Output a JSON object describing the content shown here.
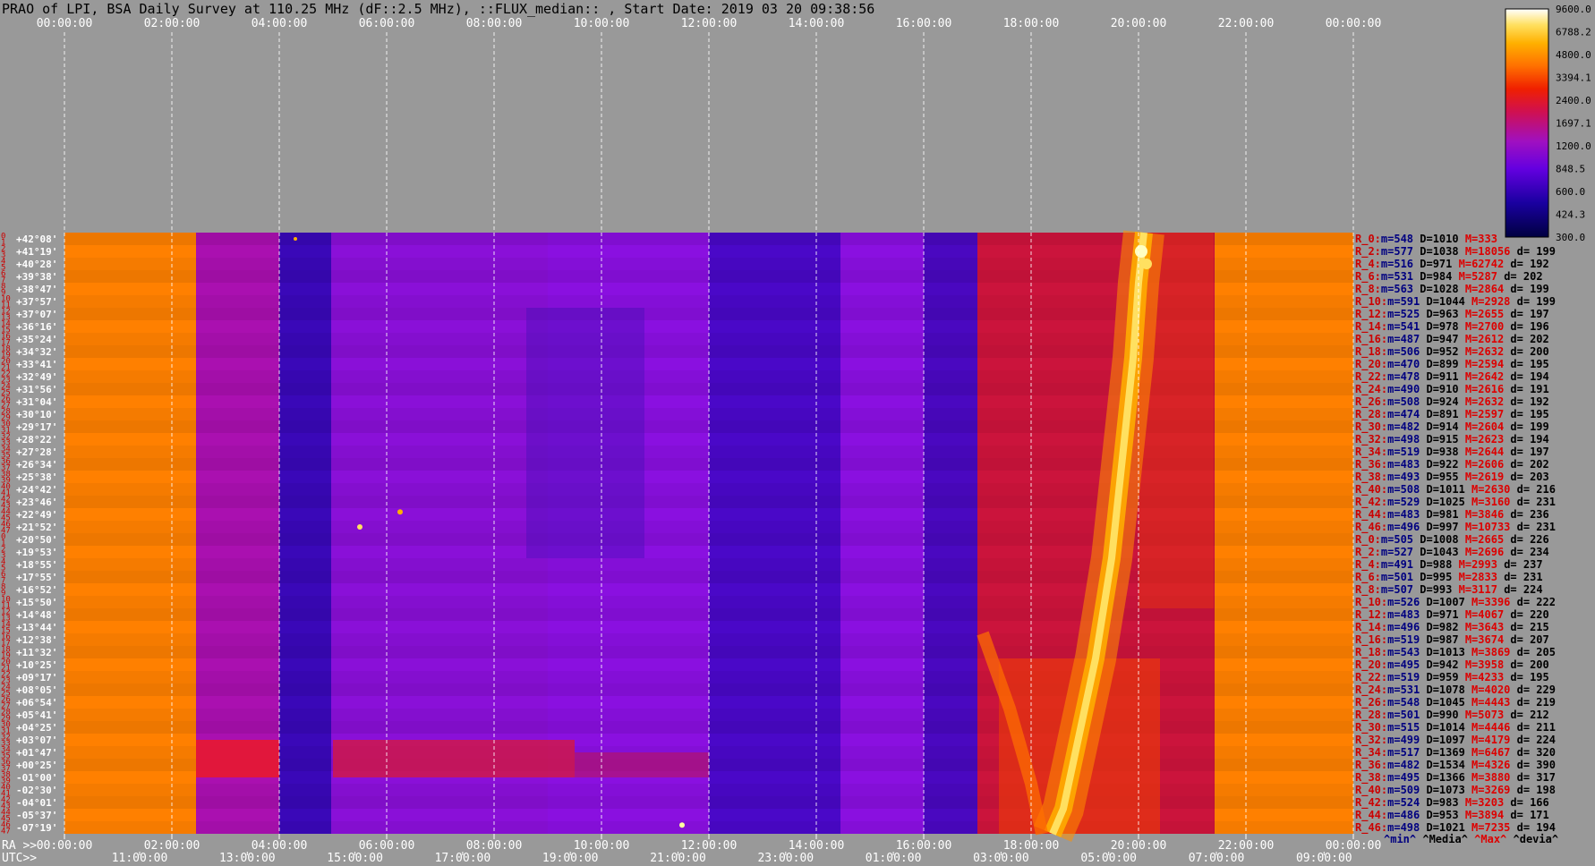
{
  "chart_data": {
    "type": "heatmap",
    "title": "PRAO of LPI, BSA Daily Survey at 110.25 MHz (dF::2.5 MHz), ::FLUX_median:: , Start Date: 2019 03 20 09:38:56",
    "x_top_ticks": [
      "00:00:00",
      "02:00:00",
      "04:00:00",
      "06:00:00",
      "08:00:00",
      "10:00:00",
      "12:00:00",
      "14:00:00",
      "16:00:00",
      "18:00:00",
      "20:00:00",
      "22:00:00",
      "00:00:00"
    ],
    "x_ra_ticks": [
      "00:00:00",
      "02:00:00",
      "04:00:00",
      "06:00:00",
      "08:00:00",
      "10:00:00",
      "12:00:00",
      "14:00:00",
      "16:00:00",
      "18:00:00",
      "20:00:00",
      "22:00:00",
      "00:00:00"
    ],
    "x_utc_ticks": [
      "11:00:00",
      "13:00:00",
      "15:00:00",
      "17:00:00",
      "19:00:00",
      "21:00:00",
      "23:00:00",
      "01:00:00",
      "03:00:00",
      "05:00:00",
      "07:00:00",
      "09:00:00"
    ],
    "ra_label": "RA >>",
    "utc_label": "UTC>>",
    "colorbar": {
      "ticks": [
        "9600.0",
        "6788.2",
        "4800.0",
        "3394.1",
        "2400.0",
        "1697.1",
        "1200.0",
        "848.5",
        "600.0",
        "424.3",
        "300.0"
      ],
      "colors": [
        "#000044",
        "#2200aa",
        "#6a00e0",
        "#a010c0",
        "#cc1040",
        "#ee2000",
        "#ff7000",
        "#ffb000",
        "#ffe060",
        "#ffffe0",
        "#ffffff"
      ]
    },
    "declinations": [
      "+42°08'",
      "+41°19'",
      "+40°28'",
      "+39°38'",
      "+38°47'",
      "+37°57'",
      "+37°07'",
      "+36°16'",
      "+35°24'",
      "+34°32'",
      "+33°41'",
      "+32°49'",
      "+31°56'",
      "+31°04'",
      "+30°10'",
      "+29°17'",
      "+28°22'",
      "+27°28'",
      "+26°34'",
      "+25°38'",
      "+24°42'",
      "+23°46'",
      "+22°49'",
      "+21°52'",
      "+20°50'",
      "+19°53'",
      "+18°55'",
      "+17°55'",
      "+16°52'",
      "+15°50'",
      "+14°48'",
      "+13°44'",
      "+12°38'",
      "+11°32'",
      "+10°25'",
      "+09°17'",
      "+08°05'",
      "+06°54'",
      "+05°41'",
      "+04°25'",
      "+03°07'",
      "+01°47'",
      "+00°25'",
      "-01°00'",
      "-02°30'",
      "-04°01'",
      "-05°37'",
      "-07°19'"
    ],
    "row_indices": [
      "0",
      "1",
      "2",
      "3",
      "4",
      "5",
      "6",
      "7",
      "8",
      "9",
      "10",
      "11",
      "12",
      "13",
      "14",
      "15",
      "16",
      "17",
      "18",
      "19",
      "20",
      "21",
      "22",
      "23",
      "24",
      "25",
      "26",
      "27",
      "28",
      "29",
      "30",
      "31",
      "32",
      "33",
      "34",
      "35",
      "36",
      "37",
      "38",
      "39",
      "40",
      "41",
      "42",
      "43",
      "44",
      "45",
      "46",
      "47",
      "0",
      "1",
      "2",
      "3",
      "4",
      "5",
      "6",
      "7",
      "8",
      "9",
      "10",
      "11",
      "12",
      "13",
      "14",
      "15",
      "16",
      "17",
      "18",
      "19",
      "20",
      "21",
      "22",
      "23",
      "24",
      "25",
      "26",
      "27",
      "28",
      "29",
      "30",
      "31",
      "32",
      "33",
      "34",
      "35",
      "36",
      "37",
      "38",
      "39",
      "40",
      "41",
      "42",
      "43",
      "44",
      "45",
      "46",
      "47"
    ],
    "row_stats": [
      {
        "label": "R_0:",
        "m": "m=548",
        "d": "D=1010",
        "M": "M=333",
        "dev": ""
      },
      {
        "label": "R_2:",
        "m": "m=577",
        "d": "D=1038",
        "M": "M=18056",
        "dev": "d= 199"
      },
      {
        "label": "R_4:",
        "m": "m=516",
        "d": "D=971",
        "M": "M=62742",
        "dev": "d= 192"
      },
      {
        "label": "R_6:",
        "m": "m=531",
        "d": "D=984",
        "M": "M=5287",
        "dev": "d= 202"
      },
      {
        "label": "R_8:",
        "m": "m=563",
        "d": "D=1028",
        "M": "M=2864",
        "dev": "d= 199"
      },
      {
        "label": "R_10:",
        "m": "m=591",
        "d": "D=1044",
        "M": "M=2928",
        "dev": "d= 199"
      },
      {
        "label": "R_12:",
        "m": "m=525",
        "d": "D=963",
        "M": "M=2655",
        "dev": "d= 197"
      },
      {
        "label": "R_14:",
        "m": "m=541",
        "d": "D=978",
        "M": "M=2700",
        "dev": "d= 196"
      },
      {
        "label": "R_16:",
        "m": "m=487",
        "d": "D=947",
        "M": "M=2612",
        "dev": "d= 202"
      },
      {
        "label": "R_18:",
        "m": "m=506",
        "d": "D=952",
        "M": "M=2632",
        "dev": "d= 200"
      },
      {
        "label": "R_20:",
        "m": "m=470",
        "d": "D=899",
        "M": "M=2594",
        "dev": "d= 195"
      },
      {
        "label": "R_22:",
        "m": "m=478",
        "d": "D=911",
        "M": "M=2642",
        "dev": "d= 194"
      },
      {
        "label": "R_24:",
        "m": "m=490",
        "d": "D=910",
        "M": "M=2616",
        "dev": "d= 191"
      },
      {
        "label": "R_26:",
        "m": "m=508",
        "d": "D=924",
        "M": "M=2632",
        "dev": "d= 192"
      },
      {
        "label": "R_28:",
        "m": "m=474",
        "d": "D=891",
        "M": "M=2597",
        "dev": "d= 195"
      },
      {
        "label": "R_30:",
        "m": "m=482",
        "d": "D=914",
        "M": "M=2604",
        "dev": "d= 199"
      },
      {
        "label": "R_32:",
        "m": "m=498",
        "d": "D=915",
        "M": "M=2623",
        "dev": "d= 194"
      },
      {
        "label": "R_34:",
        "m": "m=519",
        "d": "D=938",
        "M": "M=2644",
        "dev": "d= 197"
      },
      {
        "label": "R_36:",
        "m": "m=483",
        "d": "D=922",
        "M": "M=2606",
        "dev": "d= 202"
      },
      {
        "label": "R_38:",
        "m": "m=493",
        "d": "D=955",
        "M": "M=2619",
        "dev": "d= 203"
      },
      {
        "label": "R_40:",
        "m": "m=508",
        "d": "D=1011",
        "M": "M=2630",
        "dev": "d= 216"
      },
      {
        "label": "R_42:",
        "m": "m=529",
        "d": "D=1025",
        "M": "M=3160",
        "dev": "d= 231"
      },
      {
        "label": "R_44:",
        "m": "m=483",
        "d": "D=981",
        "M": "M=3846",
        "dev": "d= 236"
      },
      {
        "label": "R_46:",
        "m": "m=496",
        "d": "D=997",
        "M": "M=10733",
        "dev": "d= 231"
      },
      {
        "label": "R_0:",
        "m": "m=505",
        "d": "D=1008",
        "M": "M=2665",
        "dev": "d= 226"
      },
      {
        "label": "R_2:",
        "m": "m=527",
        "d": "D=1043",
        "M": "M=2696",
        "dev": "d= 234"
      },
      {
        "label": "R_4:",
        "m": "m=491",
        "d": "D=988",
        "M": "M=2993",
        "dev": "d= 237"
      },
      {
        "label": "R_6:",
        "m": "m=501",
        "d": "D=995",
        "M": "M=2833",
        "dev": "d= 231"
      },
      {
        "label": "R_8:",
        "m": "m=507",
        "d": "D=993",
        "M": "M=3117",
        "dev": "d= 224"
      },
      {
        "label": "R_10:",
        "m": "m=526",
        "d": "D=1007",
        "M": "M=3396",
        "dev": "d= 222"
      },
      {
        "label": "R_12:",
        "m": "m=483",
        "d": "D=971",
        "M": "M=4067",
        "dev": "d= 220"
      },
      {
        "label": "R_14:",
        "m": "m=496",
        "d": "D=982",
        "M": "M=3643",
        "dev": "d= 215"
      },
      {
        "label": "R_16:",
        "m": "m=519",
        "d": "D=987",
        "M": "M=3674",
        "dev": "d= 207"
      },
      {
        "label": "R_18:",
        "m": "m=543",
        "d": "D=1013",
        "M": "M=3869",
        "dev": "d= 205"
      },
      {
        "label": "R_20:",
        "m": "m=495",
        "d": "D=942",
        "M": "M=3958",
        "dev": "d= 200"
      },
      {
        "label": "R_22:",
        "m": "m=519",
        "d": "D=959",
        "M": "M=4233",
        "dev": "d= 195"
      },
      {
        "label": "R_24:",
        "m": "m=531",
        "d": "D=1078",
        "M": "M=4020",
        "dev": "d= 229"
      },
      {
        "label": "R_26:",
        "m": "m=548",
        "d": "D=1045",
        "M": "M=4443",
        "dev": "d= 219"
      },
      {
        "label": "R_28:",
        "m": "m=501",
        "d": "D=990",
        "M": "M=5073",
        "dev": "d= 212"
      },
      {
        "label": "R_30:",
        "m": "m=515",
        "d": "D=1014",
        "M": "M=4446",
        "dev": "d= 211"
      },
      {
        "label": "R_32:",
        "m": "m=499",
        "d": "D=1097",
        "M": "M=4179",
        "dev": "d= 224"
      },
      {
        "label": "R_34:",
        "m": "m=517",
        "d": "D=1369",
        "M": "M=6467",
        "dev": "d= 320"
      },
      {
        "label": "R_36:",
        "m": "m=482",
        "d": "D=1534",
        "M": "M=4326",
        "dev": "d= 390"
      },
      {
        "label": "R_38:",
        "m": "m=495",
        "d": "D=1366",
        "M": "M=3880",
        "dev": "d= 317"
      },
      {
        "label": "R_40:",
        "m": "m=509",
        "d": "D=1073",
        "M": "M=3269",
        "dev": "d= 198"
      },
      {
        "label": "R_42:",
        "m": "m=524",
        "d": "D=983",
        "M": "M=3203",
        "dev": "d= 166"
      },
      {
        "label": "R_44:",
        "m": "m=486",
        "d": "D=953",
        "M": "M=3894",
        "dev": "d= 171"
      },
      {
        "label": "R_46:",
        "m": "m=498",
        "d": "D=1021",
        "M": "M=7235",
        "dev": "d= 194"
      }
    ],
    "stat_legend": [
      "^min^",
      "^Media^",
      "^Max^",
      "^devia^"
    ],
    "bands": [
      {
        "ra_start": "00:00:00",
        "ra_end": "02:27:00",
        "level": "orange",
        "color": "#ff8000"
      },
      {
        "ra_start": "02:27:00",
        "ra_end": "04:00:00",
        "level": "magenta",
        "color": "#aa10b0"
      },
      {
        "ra_start": "04:00:00",
        "ra_end": "04:58:00",
        "level": "dark-indigo",
        "color": "#3a08b8"
      },
      {
        "ra_start": "04:58:00",
        "ra_end": "09:00:00",
        "level": "purple",
        "color": "#8a10d8"
      },
      {
        "ra_start": "09:00:00",
        "ra_end": "12:00:00",
        "level": "purple",
        "color": "#8a10e0"
      },
      {
        "ra_start": "12:00:00",
        "ra_end": "14:27:00",
        "level": "indigo",
        "color": "#4a08c8"
      },
      {
        "ra_start": "14:27:00",
        "ra_end": "16:00:00",
        "level": "violet",
        "color": "#8a10e0"
      },
      {
        "ra_start": "16:00:00",
        "ra_end": "17:00:00",
        "level": "indigo",
        "color": "#4a08c0"
      },
      {
        "ra_start": "17:00:00",
        "ra_end": "21:25:00",
        "level": "red-magenta",
        "color": "#c41040"
      },
      {
        "ra_start": "21:25:00",
        "ra_end": "24:00:00",
        "level": "orange",
        "color": "#ff8000"
      }
    ]
  }
}
